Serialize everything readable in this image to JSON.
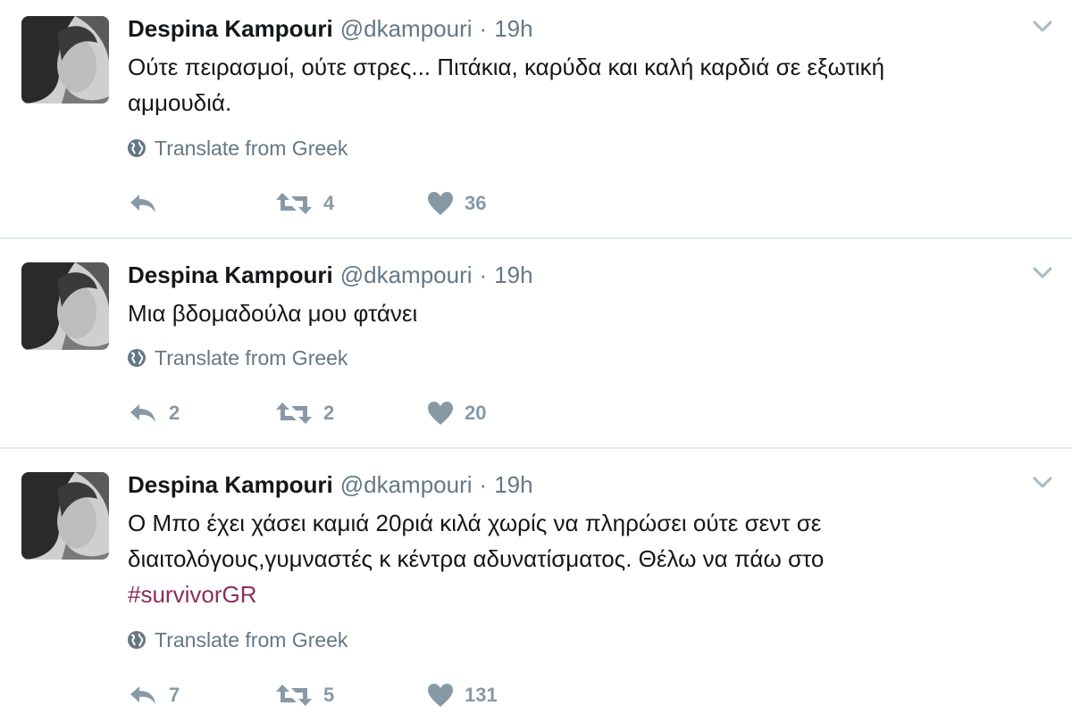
{
  "author": {
    "name": "Despina Kampouri",
    "handle": "@dkampouri"
  },
  "separator": "·",
  "translate_label": "Translate from Greek",
  "colors": {
    "text": "#14171a",
    "muted": "#657786",
    "action": "#8899a6",
    "hashtag": "#8b2d5b",
    "divider": "#e6ecf0"
  },
  "icons": [
    "chevron-down-icon",
    "globe-icon",
    "reply-icon",
    "retweet-icon",
    "heart-icon"
  ],
  "tweets": [
    {
      "time": "19h",
      "line1": "Ούτε πειρασμοί, ούτε στρες... Πιτάκια, καρύδα και καλή καρδιά σε εξωτική",
      "line2": "αμμουδιά.",
      "replies": "",
      "retweets": "4",
      "likes": "36"
    },
    {
      "time": "19h",
      "line1": "Μια βδομαδούλα μου φτάνει",
      "replies": "2",
      "retweets": "2",
      "likes": "20"
    },
    {
      "time": "19h",
      "line1": "Ο Μπο έχει χάσει καμιά 20ριά κιλά χωρίς να πληρώσει ούτε σεντ σε",
      "line2": "διαιτολόγους,γυμναστές κ κέντρα αδυνατίσματος. Θέλω να πάω στο",
      "hashtag": "#survivorGR",
      "replies": "7",
      "retweets": "5",
      "likes": "131"
    }
  ]
}
